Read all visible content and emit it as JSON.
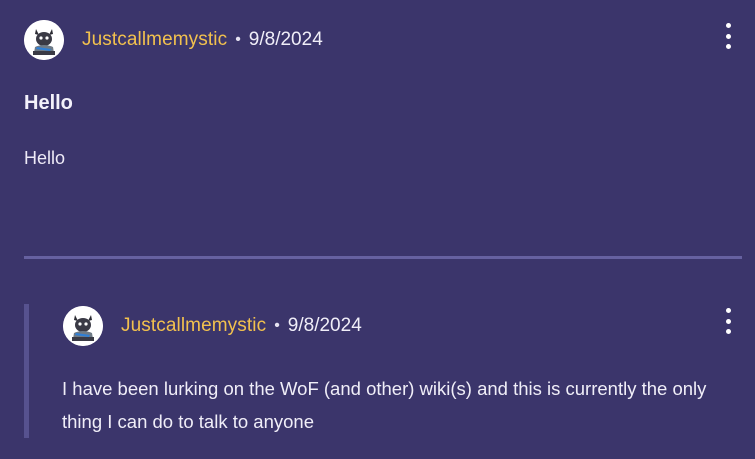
{
  "post": {
    "username": "Justcallmemystic",
    "separator": "•",
    "date": "9/8/2024",
    "title": "Hello",
    "body": "Hello",
    "avatar_icon": "dragon-avatar-icon",
    "menu_icon": "more-vertical-icon"
  },
  "reply": {
    "username": "Justcallmemystic",
    "separator": "•",
    "date": "9/8/2024",
    "body": "I have been lurking on the WoF (and other) wiki(s) and this is currently the only thing I can do to talk to anyone",
    "avatar_icon": "dragon-avatar-icon",
    "menu_icon": "more-vertical-icon"
  },
  "colors": {
    "background": "#3b356b",
    "username": "#f2c14e",
    "divider": "#6661a0",
    "reply_bar": "#57528f"
  }
}
